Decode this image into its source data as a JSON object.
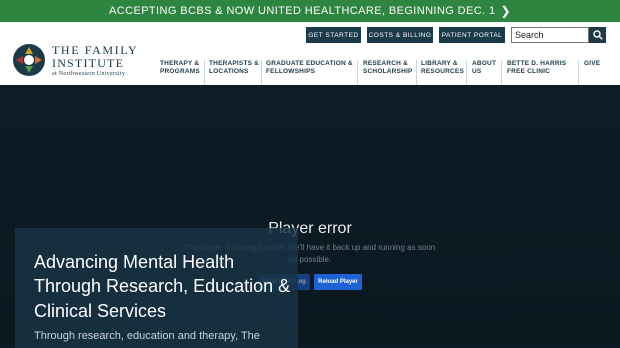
{
  "banner": {
    "text": "ACCEPTING BCBS & NOW UNITED HEALTHCARE, BEGINNING DEC. 1",
    "icon": "chevron-right-icon",
    "color": "#2e8540"
  },
  "logo": {
    "line1": "THE FAMILY",
    "line2": "INSTITUTE",
    "line3": "at Northwestern University"
  },
  "utility": {
    "get_started": "GET STARTED",
    "costs": "COSTS & BILLING",
    "portal": "PATIENT PORTAL"
  },
  "search": {
    "placeholder": "Search",
    "icon": "search-icon"
  },
  "nav": {
    "therapy": [
      "THERAPY &",
      "PROGRAMS"
    ],
    "therapists": [
      "THERAPISTS &",
      "LOCATIONS"
    ],
    "graduate": [
      "GRADUATE EDUCATION &",
      "FELLOWSHIPS"
    ],
    "research": [
      "RESEARCH &",
      "SCHOLARSHIP"
    ],
    "library": [
      "LIBRARY &",
      "RESOURCES"
    ],
    "about": [
      "ABOUT",
      "US"
    ],
    "clinic": [
      "BETTE D. HARRIS",
      "FREE CLINIC"
    ],
    "give": [
      "GIVE"
    ]
  },
  "player": {
    "error_title": "Player error",
    "error_message": "The player is having trouble. We'll have it back up and running as soon as possible.",
    "send_button": "Send Error Log",
    "reload_button": "Reload Player"
  },
  "hero": {
    "title": "Advancing Mental Health Through Research, Education & Clinical Services",
    "subtitle": "Through research, education and therapy, The"
  },
  "colors": {
    "navy": "#1b3a4a",
    "accent": "#1e63d6"
  }
}
